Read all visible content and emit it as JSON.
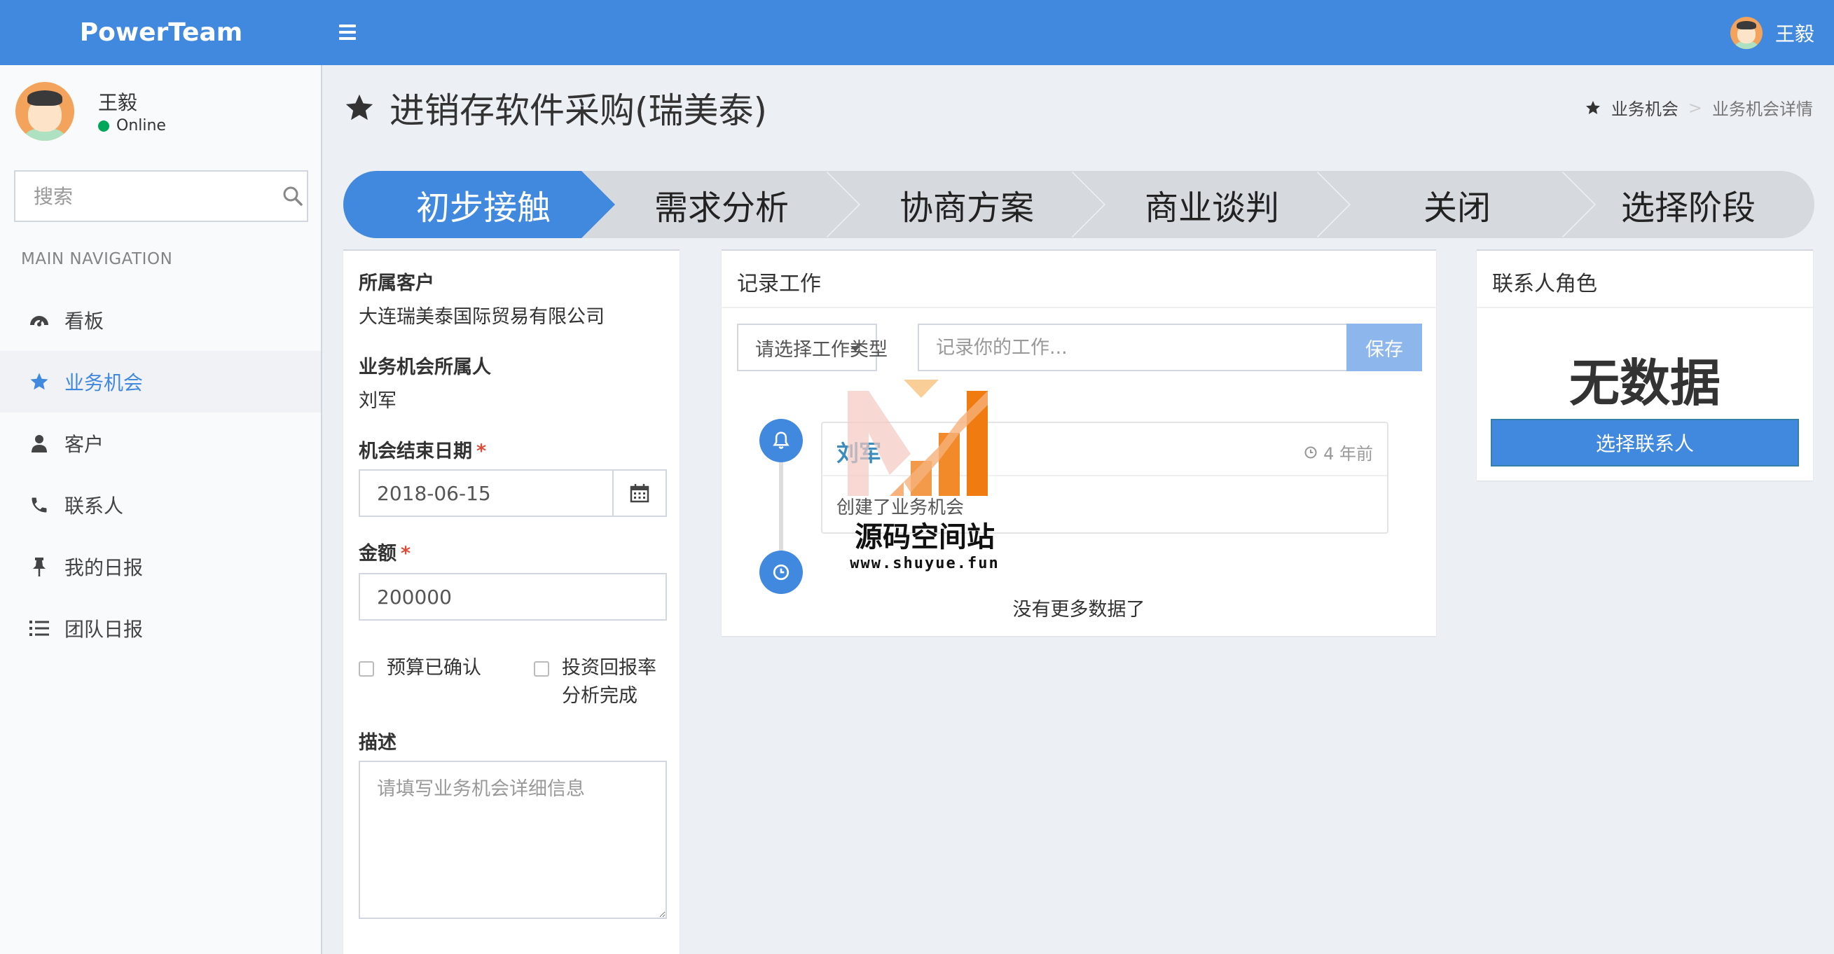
{
  "app": {
    "brand": "PowerTeam"
  },
  "topbar": {
    "user_name": "王毅"
  },
  "sidebar": {
    "user_name": "王毅",
    "status": "Online",
    "search_placeholder": "搜索",
    "nav_header": "MAIN NAVIGATION",
    "items": [
      {
        "label": "看板",
        "icon": "dashboard-icon"
      },
      {
        "label": "业务机会",
        "icon": "star-icon",
        "active": true
      },
      {
        "label": "客户",
        "icon": "user-icon"
      },
      {
        "label": "联系人",
        "icon": "phone-icon"
      },
      {
        "label": "我的日报",
        "icon": "pin-icon"
      },
      {
        "label": "团队日报",
        "icon": "list-icon"
      }
    ]
  },
  "page": {
    "title": "进销存软件采购(瑞美泰)",
    "breadcrumb": {
      "parent": "业务机会",
      "separator": ">",
      "current": "业务机会详情"
    }
  },
  "stages": [
    {
      "label": "初步接触",
      "active": true
    },
    {
      "label": "需求分析"
    },
    {
      "label": "协商方案"
    },
    {
      "label": "商业谈判"
    },
    {
      "label": "关闭"
    },
    {
      "label": "选择阶段"
    }
  ],
  "details": {
    "customer_label": "所属客户",
    "customer_value": "大连瑞美泰国际贸易有限公司",
    "owner_label": "业务机会所属人",
    "owner_value": "刘军",
    "end_date_label": "机会结束日期",
    "end_date_value": "2018-06-15",
    "amount_label": "金额",
    "amount_value": "200000",
    "required_mark": "*",
    "budget_confirmed_label": "预算已确认",
    "roi_line1": "投资回报率",
    "roi_line2": "分析完成",
    "desc_label": "描述",
    "desc_placeholder": "请填写业务机会详细信息"
  },
  "work_log": {
    "title": "记录工作",
    "type_placeholder": "请选择工作类型",
    "input_placeholder": "记录你的工作...",
    "save_label": "保存",
    "timeline": [
      {
        "name": "刘军",
        "time": "4 年前",
        "content": "创建了业务机会"
      }
    ],
    "no_more": "没有更多数据了"
  },
  "contacts": {
    "title": "联系人角色",
    "empty": "无数据",
    "select_label": "选择联系人"
  },
  "watermark": {
    "name": "源码空间站",
    "url": "www.shuyue.fun"
  }
}
